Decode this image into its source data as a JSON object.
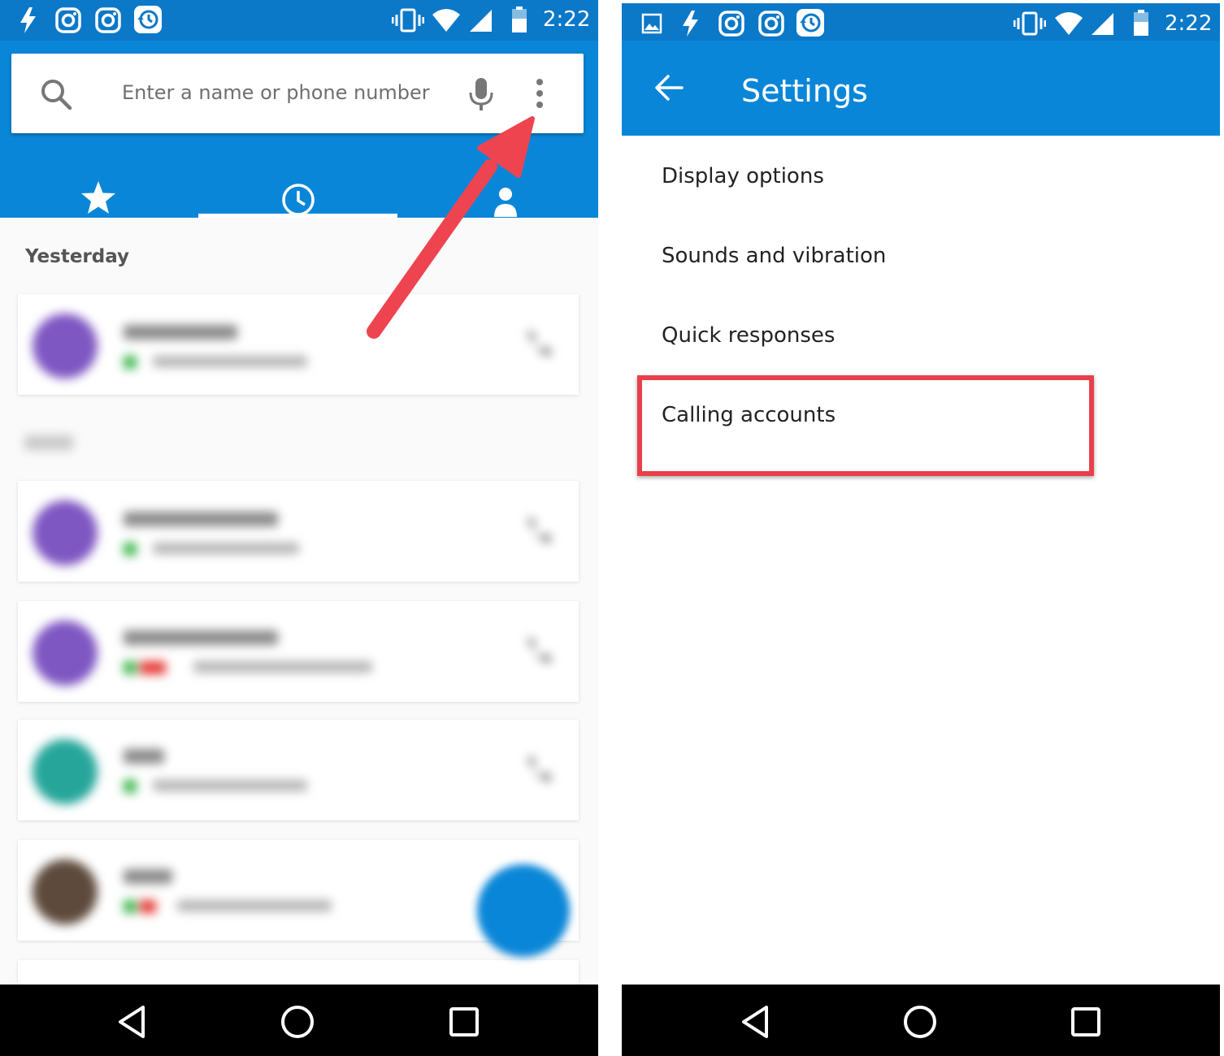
{
  "status_bar": {
    "time_left": "2:22",
    "time_right": "2:22",
    "icons": [
      "flash-icon",
      "instagram-icon",
      "instagram-icon",
      "backup-icon",
      "vibrate-icon",
      "wifi-icon",
      "signal-icon",
      "battery-icon"
    ]
  },
  "dialer": {
    "search_placeholder": "Enter a name or phone number",
    "tabs": [
      {
        "name": "favorites",
        "icon": "star-icon"
      },
      {
        "name": "recents",
        "icon": "clock-icon",
        "selected": true
      },
      {
        "name": "contacts",
        "icon": "people-icon"
      }
    ],
    "section_yesterday": "Yesterday"
  },
  "settings": {
    "title": "Settings",
    "items": [
      {
        "label": "Display options"
      },
      {
        "label": "Sounds and vibration"
      },
      {
        "label": "Quick responses"
      },
      {
        "label": "Calling accounts",
        "highlighted": true
      }
    ]
  },
  "colors": {
    "status_bar": "#0b78c8",
    "app_bar": "#0a86d8",
    "highlight": "#e8404a",
    "arrow": "#ee4450"
  }
}
